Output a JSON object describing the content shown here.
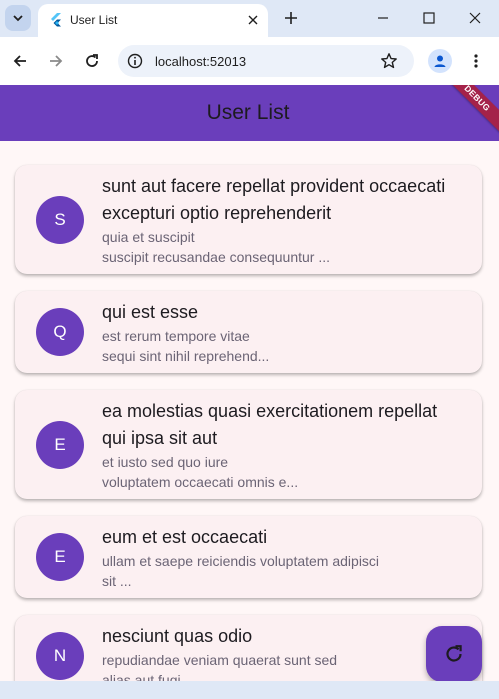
{
  "browser": {
    "tab_title": "User List",
    "url": "localhost:52013"
  },
  "app": {
    "title": "User List",
    "debug_banner": "DEBUG"
  },
  "posts": [
    {
      "initial": "S",
      "title": "sunt aut facere repellat provident occaecati excepturi optio reprehenderit",
      "body_line1": "quia et suscipit",
      "body_line2": "suscipit recusandae consequuntur ..."
    },
    {
      "initial": "Q",
      "title": "qui est esse",
      "body_line1": "est rerum tempore vitae",
      "body_line2": "sequi sint nihil reprehend..."
    },
    {
      "initial": "E",
      "title": "ea molestias quasi exercitationem repellat qui ipsa sit aut",
      "body_line1": "et iusto sed quo iure",
      "body_line2": "voluptatem occaecati omnis e..."
    },
    {
      "initial": "E",
      "title": "eum et est occaecati",
      "body_line1": "ullam et saepe reiciendis voluptatem adipisci",
      "body_line2": "sit ..."
    },
    {
      "initial": "N",
      "title": "nesciunt quas odio",
      "body_line1": "repudiandae veniam quaerat sunt sed",
      "body_line2": "alias aut fugi..."
    }
  ],
  "icons": {
    "tab_menu": "chevron-down-icon",
    "favicon": "flutter-icon",
    "tab_close": "close-icon",
    "new_tab": "plus-icon",
    "minimize": "minimize-icon",
    "maximize": "maximize-icon",
    "close_window": "close-icon",
    "back": "arrow-left-icon",
    "forward": "arrow-right-icon",
    "reload": "reload-icon",
    "site_info": "info-icon",
    "bookmark": "star-icon",
    "profile": "person-icon",
    "menu": "more-vertical-icon",
    "refresh_fab": "refresh-icon"
  },
  "colors": {
    "primary": "#6a3ebb",
    "card_bg": "#fcf0f2",
    "page_bg": "#fff7f7",
    "debug_banner": "#a4224a"
  }
}
